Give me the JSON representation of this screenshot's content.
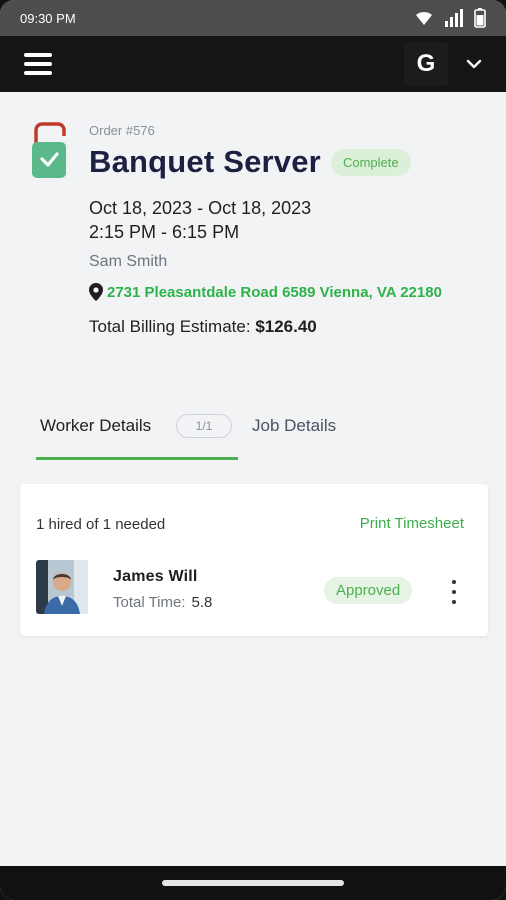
{
  "status_bar": {
    "time": "09:30 PM"
  },
  "app_bar": {
    "avatar_letter": "G"
  },
  "order": {
    "number": "Order #576",
    "title": "Banquet Server",
    "status": "Complete",
    "date_range": "Oct 18, 2023 - Oct 18, 2023",
    "time_range": "2:15 PM - 6:15 PM",
    "client": "Sam Smith",
    "address": "2731 Pleasantdale Road 6589 Vienna, VA 22180",
    "billing_label": "Total Billing Estimate:",
    "billing_value": "$126.40"
  },
  "tabs": {
    "worker_details": "Worker Details",
    "worker_count": "1/1",
    "job_details": "Job Details"
  },
  "worker_card": {
    "hired_text": "1 hired of 1 needed",
    "print_label": "Print Timesheet",
    "worker": {
      "name": "James Will",
      "total_time_label": "Total Time:",
      "total_time_value": "5.8",
      "status": "Approved"
    }
  },
  "colors": {
    "accent_green": "#4caf50",
    "app_bar": "#151515",
    "title_navy": "#1c2142"
  }
}
